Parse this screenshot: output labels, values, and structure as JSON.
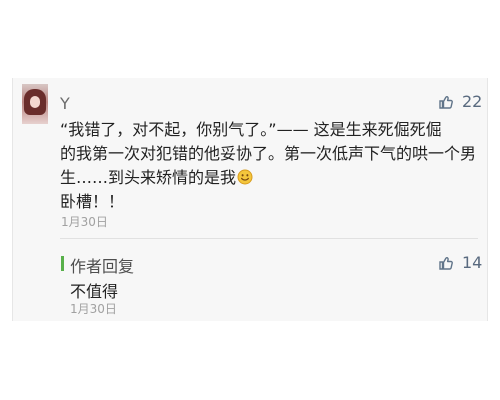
{
  "comment": {
    "username": "Y",
    "likes": "22",
    "lines": [
      "“我错了，对不起，你别气了。”—— 这是生来死倔死倔",
      "的我第一次对犯错的他妥协了。第一次低声下气的哄一个男",
      "生……到头来矫情的是我",
      "卧槽！！"
    ],
    "date": "1月30日"
  },
  "author_reply": {
    "label": "作者回复",
    "likes": "14",
    "text": "不值得",
    "date": "1月30日"
  }
}
